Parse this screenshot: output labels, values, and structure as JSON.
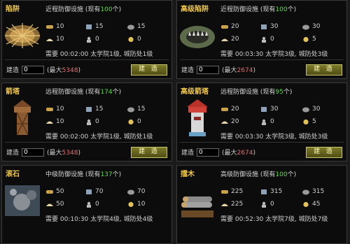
{
  "ui": {
    "build_label": "建造",
    "max_prefix": "(最大",
    "max_suffix": ")",
    "button_label": "建 造"
  },
  "cards": [
    {
      "name": "陷阱",
      "desc_pre": "近程防御设施 (现有",
      "count": "100",
      "desc_post": "个)",
      "res": [
        "10",
        "15",
        "15",
        "10",
        "0",
        "0"
      ],
      "req": "需要 00:02:00 太学院1级, 城防处1级",
      "qty": "0",
      "max": "5348"
    },
    {
      "name": "高级陷阱",
      "desc_pre": "近程防御设施 (现有",
      "count": "100",
      "desc_post": "个)",
      "res": [
        "20",
        "30",
        "30",
        "20",
        "0",
        "5"
      ],
      "req": "需要 00:03:30 太学院3级, 城防处3级",
      "qty": "0",
      "max": "2674"
    },
    {
      "name": "箭塔",
      "desc_pre": "远程防御设施 (现有",
      "count": "174",
      "desc_post": "个)",
      "res": [
        "10",
        "15",
        "15",
        "10",
        "0",
        "0"
      ],
      "req": "需要 00:02:00 太学院1级, 城防处1级",
      "qty": "0",
      "max": "5348"
    },
    {
      "name": "高级箭塔",
      "desc_pre": "远程防御设施 (现有",
      "count": "95",
      "desc_post": "个)",
      "res": [
        "20",
        "30",
        "30",
        "20",
        "0",
        "5"
      ],
      "req": "需要 00:03:30 太学院3级, 城防处3级",
      "qty": "0",
      "max": "2674"
    },
    {
      "name": "滚石",
      "desc_pre": "中级防御设施 (现有",
      "count": "137",
      "desc_post": "个)",
      "res": [
        "50",
        "70",
        "70",
        "50",
        "0",
        "10"
      ],
      "req": "需要 00:10:30 太学院4级, 城防处4级",
      "qty": "",
      "max": ""
    },
    {
      "name": "擂木",
      "desc_pre": "高级防御设施 (现有",
      "count": "100",
      "desc_post": "个)",
      "res": [
        "225",
        "315",
        "315",
        "225",
        "0",
        "45"
      ],
      "req": "需要 00:52:30 太学院7级, 城防处7级",
      "qty": "",
      "max": ""
    }
  ]
}
